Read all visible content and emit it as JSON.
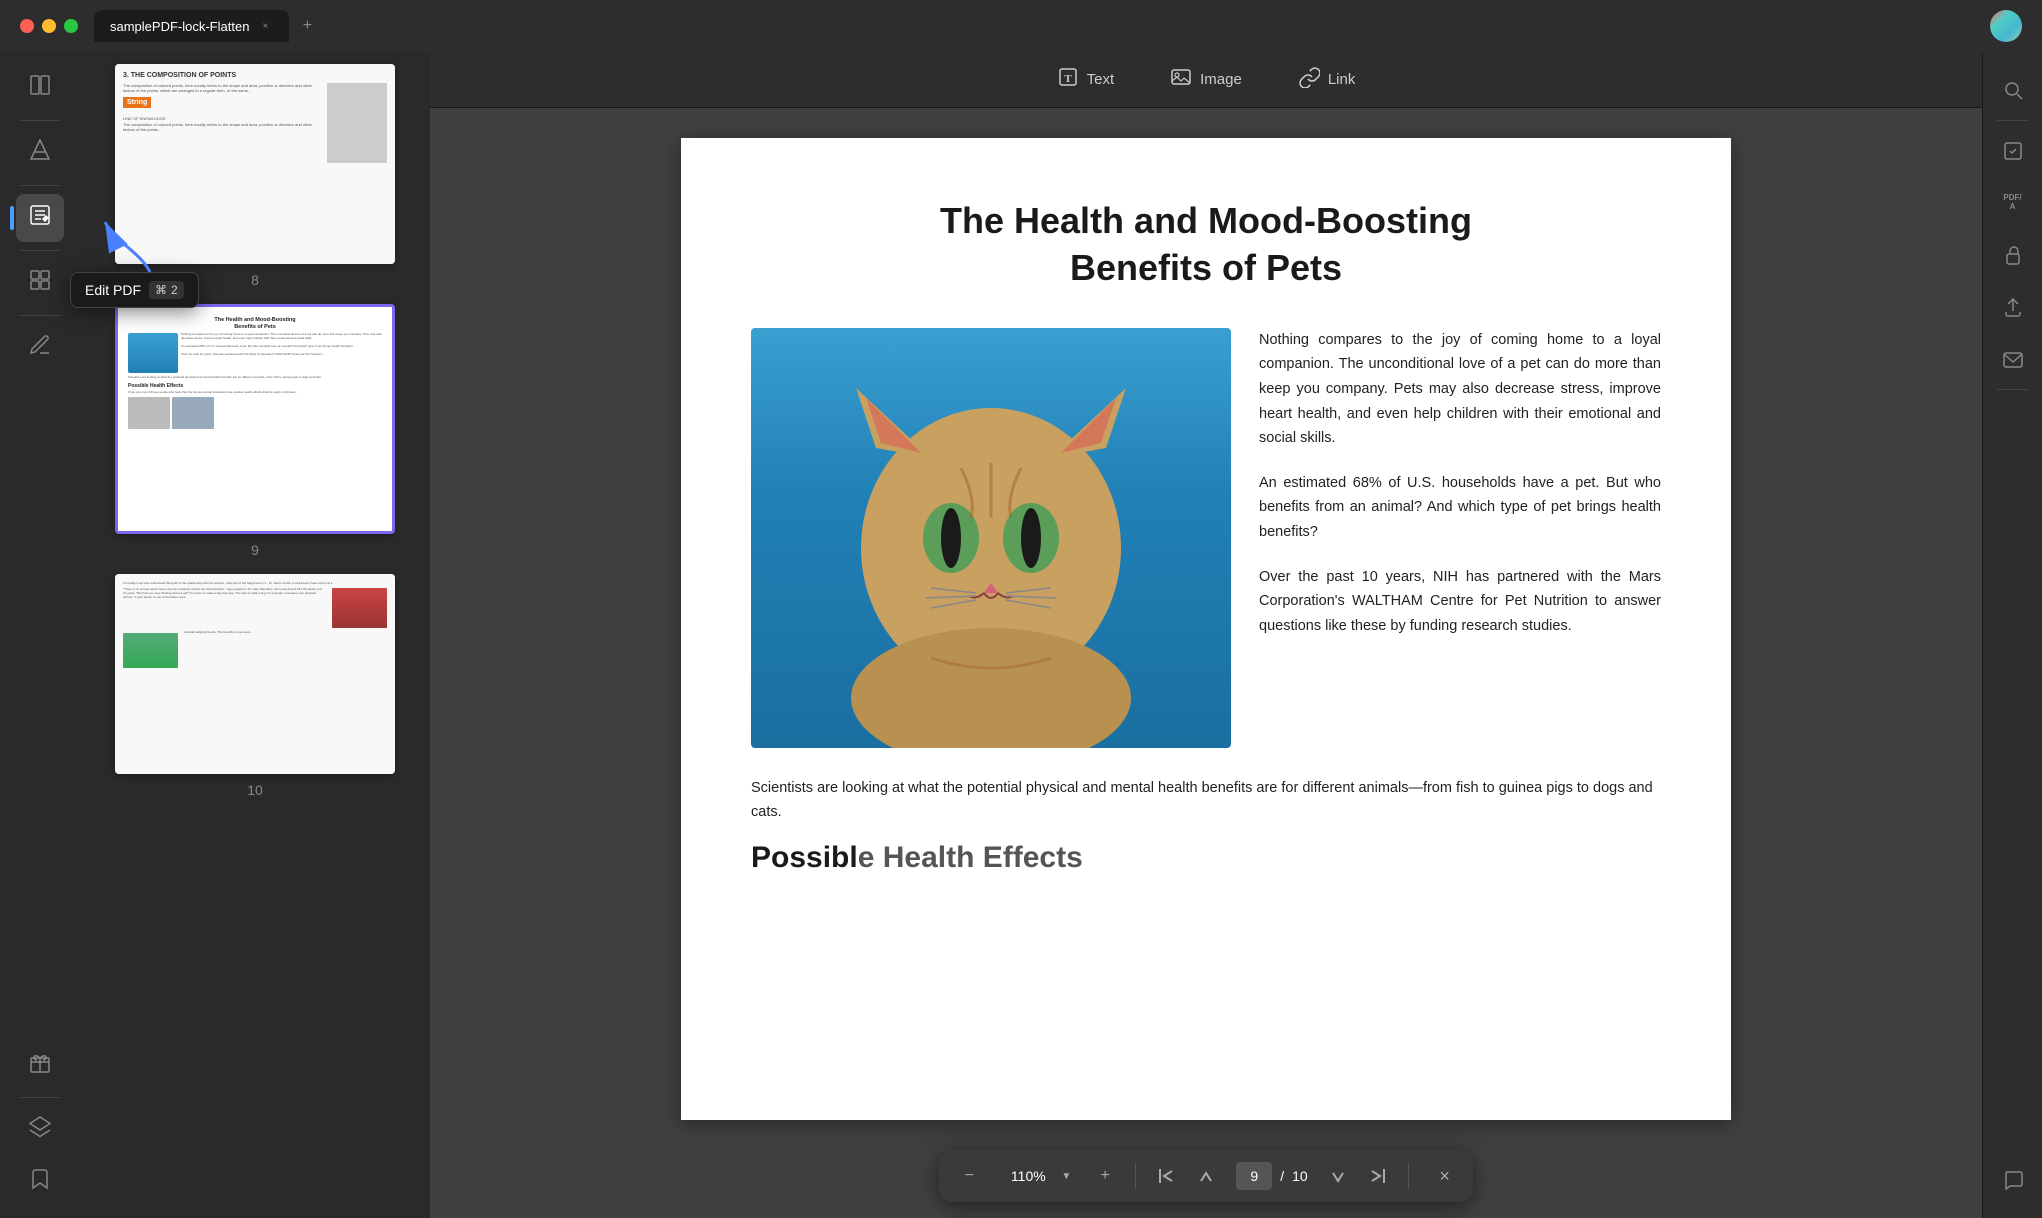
{
  "titlebar": {
    "tab_label": "samplePDF-lock-Flatten",
    "close_symbol": "×",
    "add_symbol": "+",
    "logo_alt": "app-logo"
  },
  "toolbar": {
    "text_label": "Text",
    "image_label": "Image",
    "link_label": "Link"
  },
  "tooltip": {
    "label": "Edit PDF",
    "shortcut_symbol": "⌘",
    "shortcut_key": "2"
  },
  "sidebar": {
    "icons": [
      {
        "name": "reader-icon",
        "symbol": "≡",
        "active": false
      },
      {
        "name": "highlight-icon",
        "symbol": "✏",
        "active": false
      },
      {
        "name": "edit-pdf-icon",
        "symbol": "✎",
        "active": true
      },
      {
        "name": "organize-icon",
        "symbol": "⊞",
        "active": false
      },
      {
        "name": "annotate-icon",
        "symbol": "◈",
        "active": false
      },
      {
        "name": "gift-icon",
        "symbol": "🎁",
        "active": false
      },
      {
        "name": "layers-icon",
        "symbol": "⧉",
        "active": false
      },
      {
        "name": "bookmark-icon",
        "symbol": "🔖",
        "active": false
      }
    ]
  },
  "thumbnails": [
    {
      "page_num": "8",
      "selected": false
    },
    {
      "page_num": "9",
      "selected": true
    },
    {
      "page_num": "10",
      "selected": false
    }
  ],
  "pdf_page": {
    "title": "The Health and Mood-Boosting\nBenefits of Pets",
    "paragraph1": "Nothing compares to the joy of coming home to a loyal companion. The unconditional love of a pet can do more than keep you company. Pets may also decrease stress, improve heart health,  and  even  help children  with  their emotional and social skills.",
    "paragraph2": "An estimated 68% of U.S. households have a pet. But who benefits from an animal? And which type of pet brings health benefits?",
    "paragraph3": "Over  the  past  10  years,  NIH  has partnered with the Mars Corporation's WALTHAM Centre  for  Pet  Nutrition  to answer  questions  like these by funding research studies.",
    "bottom_text": "Scientists are looking at what the potential physical and mental health benefits are for different animals—from fish to guinea pigs to dogs and cats.",
    "possible_title": "Possibl"
  },
  "bottom_nav": {
    "zoom_minus": "−",
    "zoom_value": "110%",
    "zoom_plus": "+",
    "first_page": "⇤",
    "prev_page": "↑",
    "page_current": "9",
    "page_separator": "/",
    "page_total": "10",
    "next_page": "↓",
    "last_page": "⇥",
    "close": "×"
  },
  "right_sidebar": {
    "icons": [
      {
        "name": "search-icon",
        "symbol": "🔍"
      },
      {
        "name": "properties-icon",
        "symbol": "⊡"
      },
      {
        "name": "pdf-a-icon",
        "symbol": "PDF/A"
      },
      {
        "name": "protect-icon",
        "symbol": "🔒"
      },
      {
        "name": "share-icon",
        "symbol": "↑"
      },
      {
        "name": "mail-icon",
        "symbol": "✉"
      },
      {
        "name": "chat-icon",
        "symbol": "💬"
      }
    ]
  }
}
